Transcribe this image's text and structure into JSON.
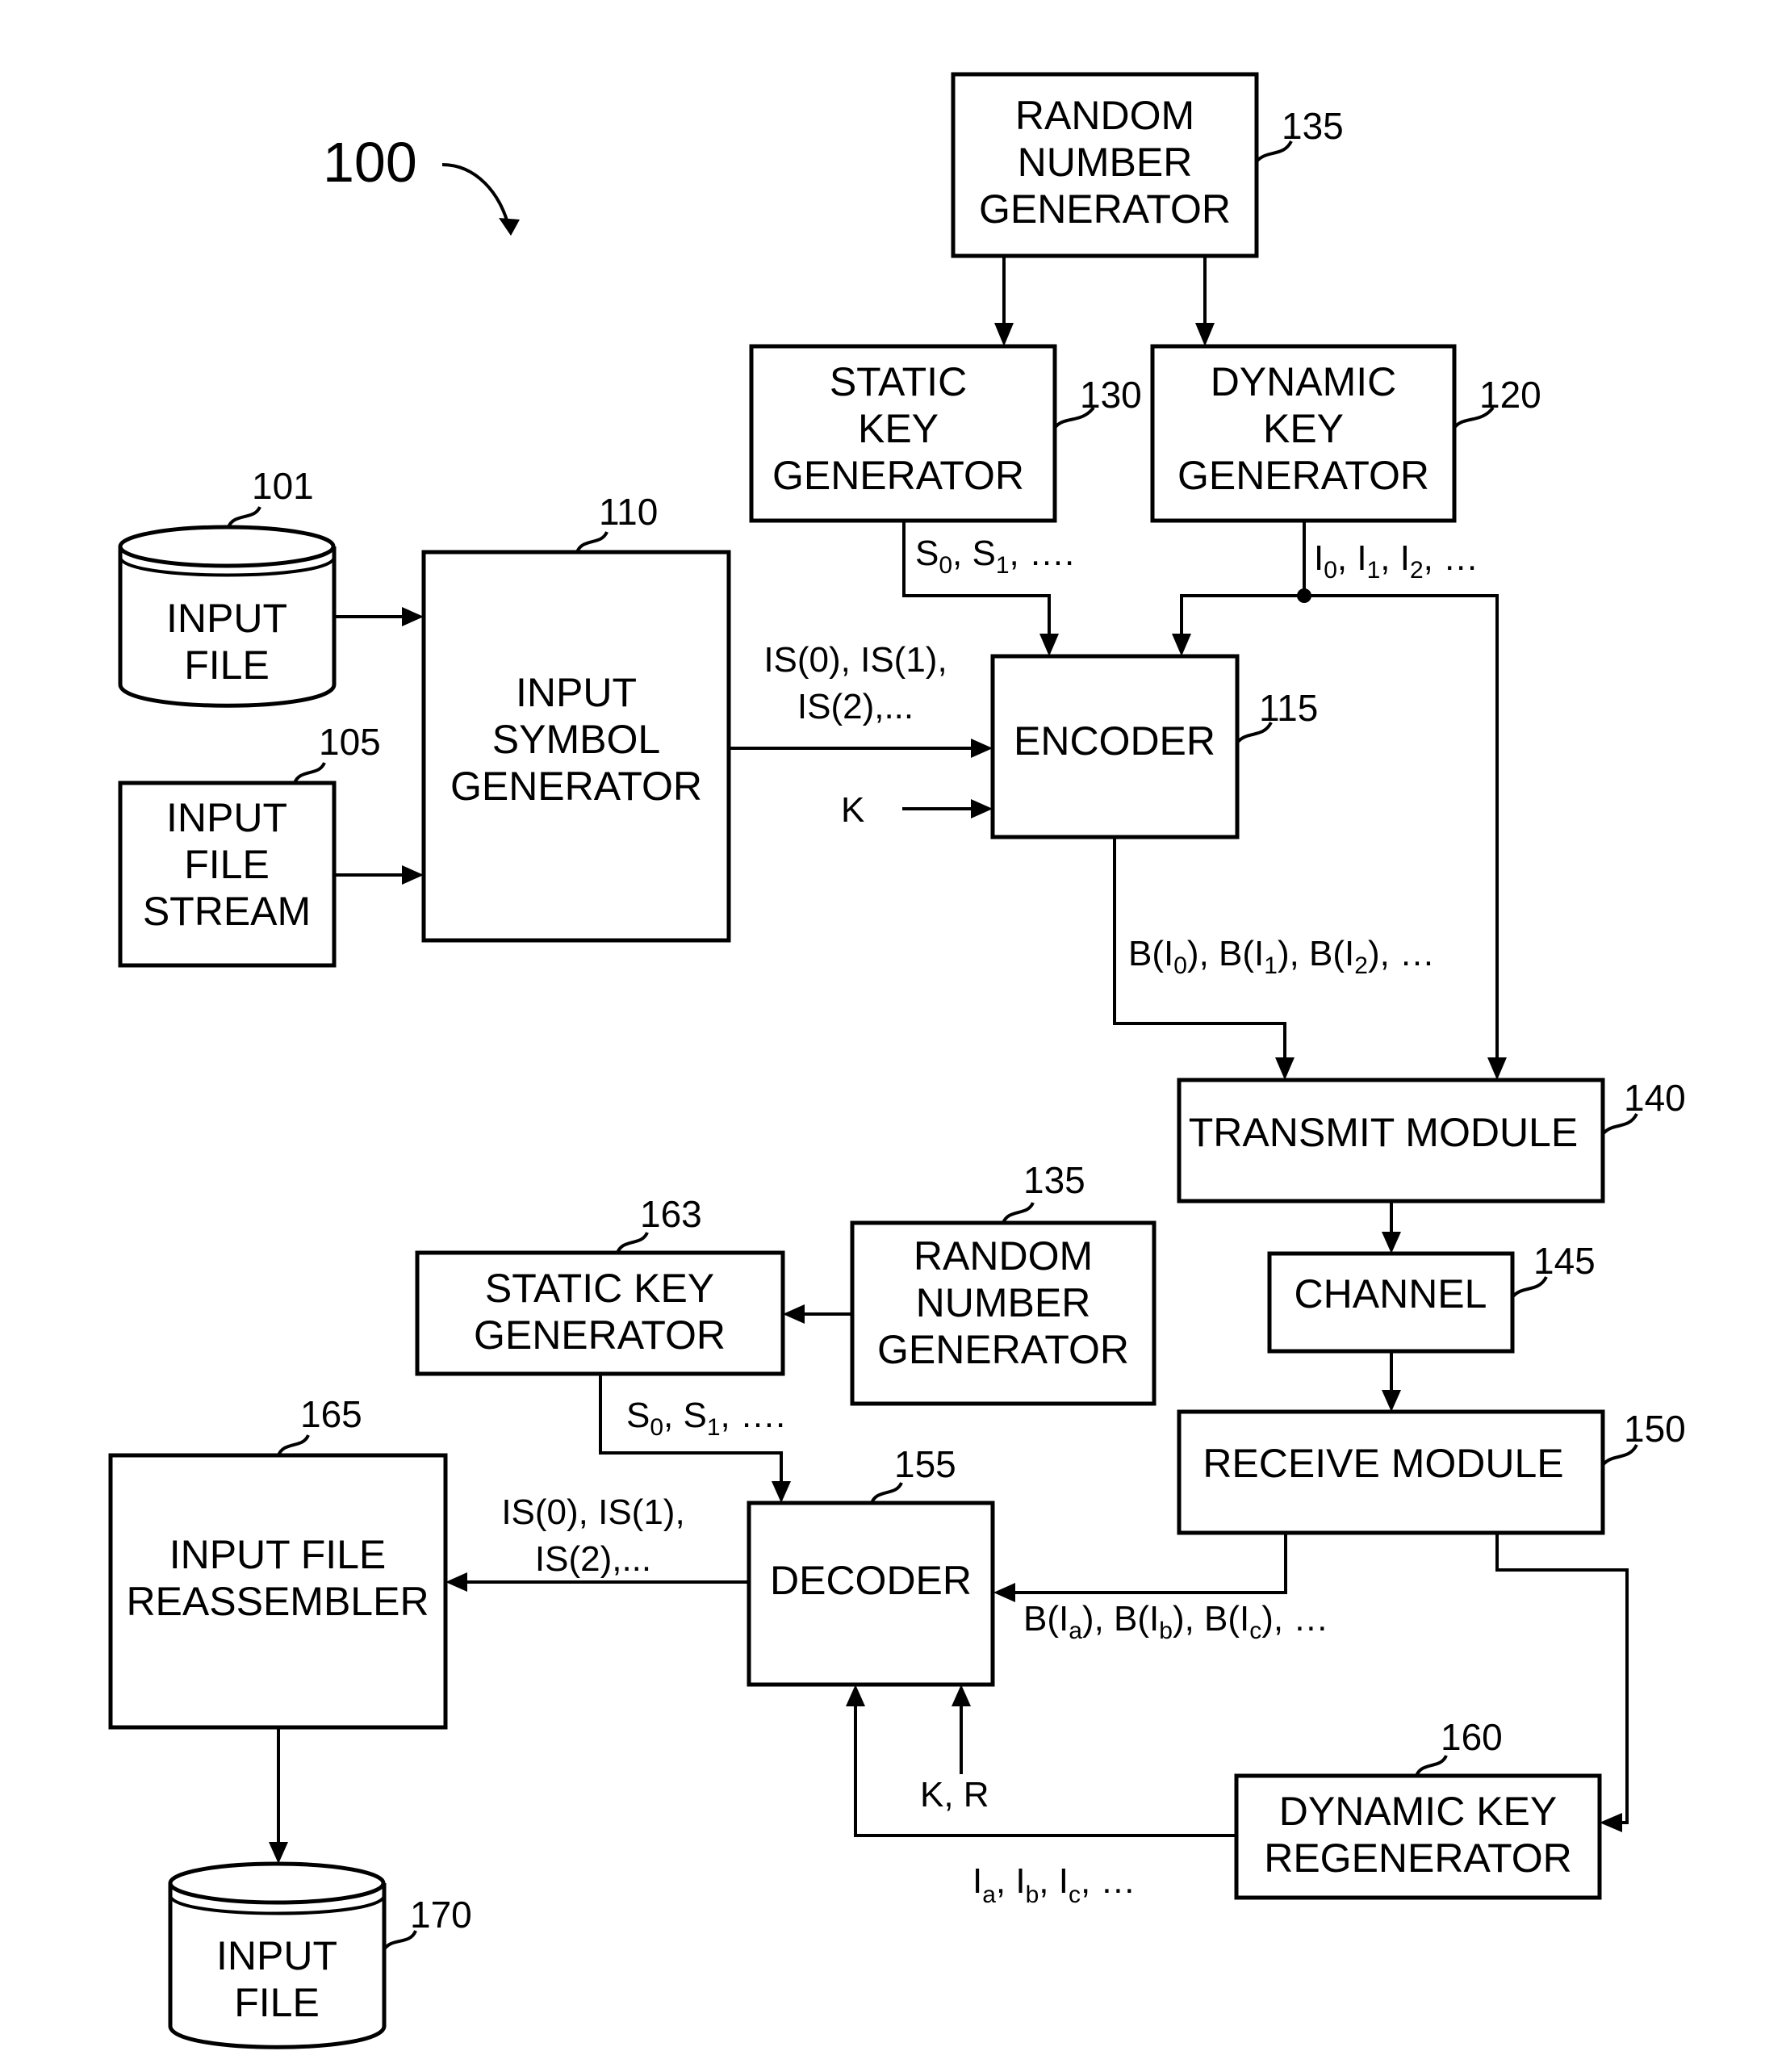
{
  "figure": {
    "number": "100"
  },
  "blocks": {
    "input_file_top": {
      "ref": "101",
      "lines": [
        "INPUT",
        "FILE"
      ]
    },
    "input_file_stream": {
      "ref": "105",
      "lines": [
        "INPUT",
        "FILE",
        "STREAM"
      ]
    },
    "input_symbol_generator": {
      "ref": "110",
      "lines": [
        "INPUT",
        "SYMBOL",
        "GENERATOR"
      ]
    },
    "encoder": {
      "ref": "115",
      "lines": [
        "ENCODER"
      ]
    },
    "dynamic_key_generator": {
      "ref": "120",
      "lines": [
        "DYNAMIC",
        "KEY",
        "GENERATOR"
      ]
    },
    "static_key_generator": {
      "ref": "130",
      "lines": [
        "STATIC",
        "KEY",
        "GENERATOR"
      ]
    },
    "random_number_generator_top": {
      "ref": "135",
      "lines": [
        "RANDOM",
        "NUMBER",
        "GENERATOR"
      ]
    },
    "transmit_module": {
      "ref": "140",
      "lines": [
        "TRANSMIT MODULE"
      ]
    },
    "channel": {
      "ref": "145",
      "lines": [
        "CHANNEL"
      ]
    },
    "receive_module": {
      "ref": "150",
      "lines": [
        "RECEIVE MODULE"
      ]
    },
    "decoder": {
      "ref": "155",
      "lines": [
        "DECODER"
      ]
    },
    "dynamic_key_regenerator": {
      "ref": "160",
      "lines": [
        "DYNAMIC KEY",
        "REGENERATOR"
      ]
    },
    "static_key_generator_bottom": {
      "ref": "163",
      "lines": [
        "STATIC KEY",
        "GENERATOR"
      ]
    },
    "random_number_generator_bottom": {
      "ref": "135",
      "lines": [
        "RANDOM",
        "NUMBER",
        "GENERATOR"
      ]
    },
    "input_file_reassembler": {
      "ref": "165",
      "lines": [
        "INPUT FILE",
        "REASSEMBLER"
      ]
    },
    "input_file_bottom": {
      "ref": "170",
      "lines": [
        "INPUT",
        "FILE"
      ]
    }
  },
  "signals": {
    "static_keys_top": {
      "parts": [
        "S",
        "0",
        ", S",
        "1",
        ", …."
      ]
    },
    "dynamic_keys_top": {
      "parts": [
        "I",
        "0",
        ",  I",
        "1",
        ",  I",
        "2",
        ",  …"
      ]
    },
    "input_symbols_top": {
      "lines": [
        "IS(0), IS(1),",
        "IS(2),..."
      ]
    },
    "k_input": "K",
    "output_symbols": {
      "parts": [
        "B(I",
        "0",
        "), B(I",
        "1",
        "), B(I",
        "2",
        "),  …"
      ]
    },
    "static_keys_bottom": {
      "parts": [
        "S",
        "0",
        ", S",
        "1",
        ", …."
      ]
    },
    "input_symbols_bottom": {
      "lines": [
        "IS(0), IS(1),",
        "IS(2),..."
      ]
    },
    "received_symbols": {
      "parts": [
        "B(I",
        "a",
        "),  B(I",
        "b",
        "),  B(I",
        "c",
        "),  …"
      ]
    },
    "kr_input": "K, R",
    "dynamic_keys_bottom": {
      "parts": [
        "I",
        "a",
        ",  I",
        "b",
        ",  I",
        "c",
        ",  …"
      ]
    }
  }
}
